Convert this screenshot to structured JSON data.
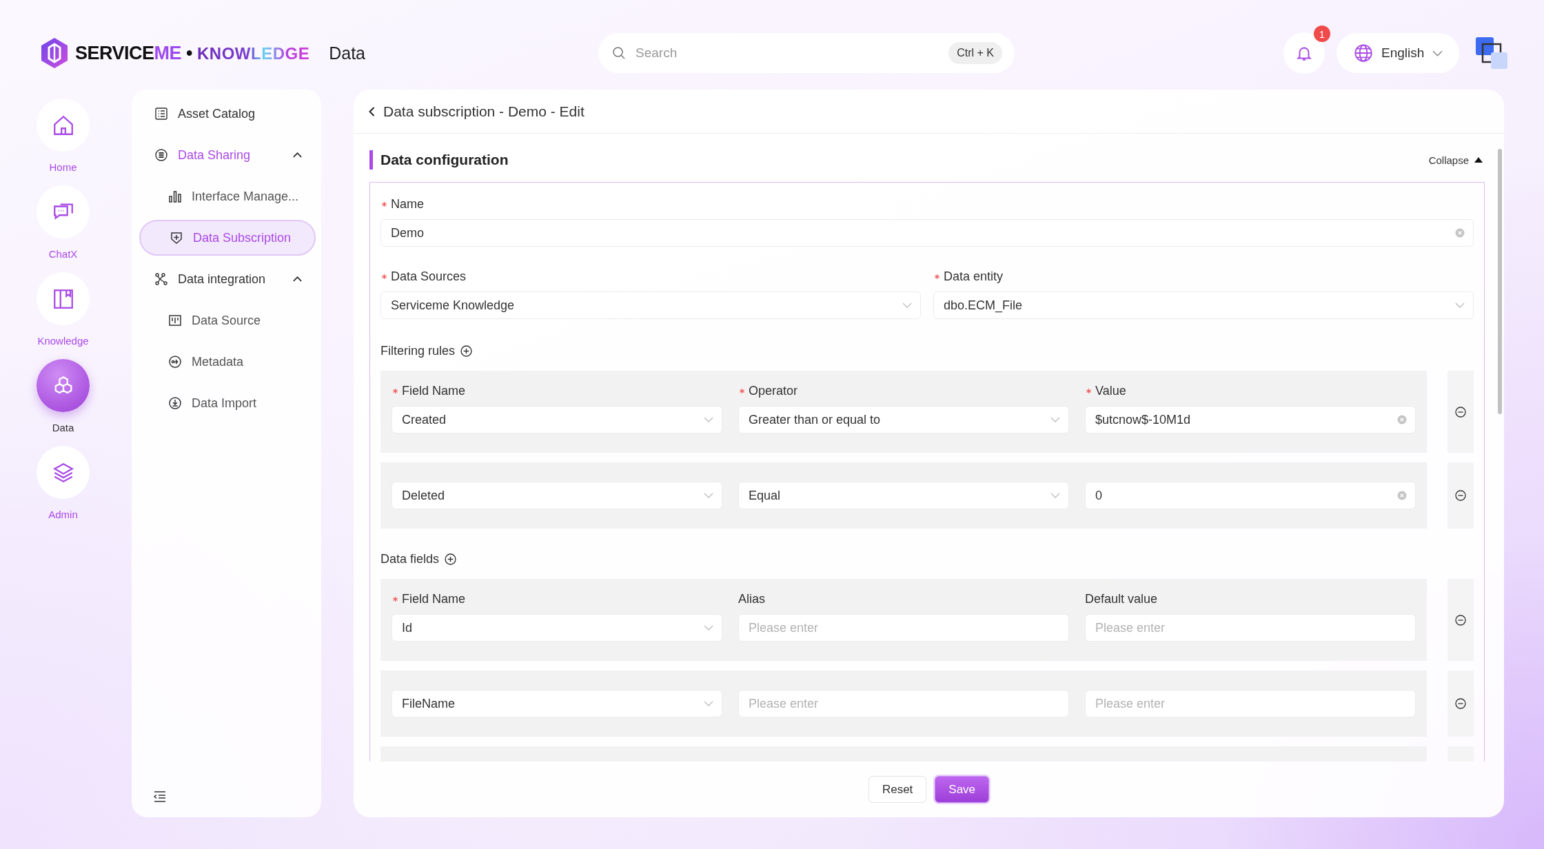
{
  "logo": {
    "name": "SERVICE",
    "name_accent": "ME",
    "separator": "•",
    "product": "KNOWLEDGE"
  },
  "app_section": "Data",
  "search": {
    "placeholder": "Search",
    "shortcut": "Ctrl + K"
  },
  "notifications": {
    "count": "1"
  },
  "language": {
    "label": "English"
  },
  "rail": [
    {
      "label": "Home",
      "selected": false
    },
    {
      "label": "ChatX",
      "selected": false
    },
    {
      "label": "Knowledge",
      "selected": false
    },
    {
      "label": "Data",
      "selected": true
    },
    {
      "label": "Admin",
      "selected": false
    }
  ],
  "sidebar": {
    "items": [
      {
        "label": "Asset Catalog",
        "selected": false
      },
      {
        "label": "Data Sharing",
        "selected": true,
        "expanded": true,
        "children": [
          {
            "label": "Interface Manage...",
            "selected": false
          },
          {
            "label": "Data Subscription",
            "selected": true
          }
        ]
      },
      {
        "label": "Data integration",
        "selected": false,
        "expanded": true,
        "children": [
          {
            "label": "Data Source",
            "selected": false
          },
          {
            "label": "Metadata",
            "selected": false
          },
          {
            "label": "Data Import",
            "selected": false
          }
        ]
      }
    ]
  },
  "page": {
    "title": "Data subscription - Demo - Edit"
  },
  "section": {
    "title": "Data configuration",
    "toggle_label": "Collapse",
    "expanded": true
  },
  "form": {
    "name": {
      "label": "Name",
      "required": true,
      "kind": "text",
      "value": "Demo"
    },
    "data_sources": {
      "label": "Data Sources",
      "required": true,
      "kind": "select",
      "value": "Serviceme Knowledge"
    },
    "data_entity": {
      "label": "Data entity",
      "required": true,
      "kind": "select",
      "value": "dbo.ECM_File"
    },
    "filtering_rules": {
      "label": "Filtering rules",
      "rows": [
        {
          "cells": [
            {
              "label": "Field Name",
              "required": true,
              "kind": "select",
              "value": "Created"
            },
            {
              "label": "Operator",
              "required": true,
              "kind": "select",
              "value": "Greater than or equal to"
            },
            {
              "label": "Value",
              "required": true,
              "kind": "text",
              "value": "$utcnow$-10M1d"
            }
          ]
        },
        {
          "cells": [
            {
              "kind": "select",
              "value": "Deleted"
            },
            {
              "kind": "select",
              "value": "Equal"
            },
            {
              "kind": "text",
              "value": "0"
            }
          ]
        }
      ]
    },
    "data_fields": {
      "label": "Data fields",
      "rows": [
        {
          "cells": [
            {
              "label": "Field Name",
              "required": true,
              "kind": "select",
              "value": "Id"
            },
            {
              "label": "Alias",
              "required": false,
              "kind": "input",
              "placeholder": "Please enter"
            },
            {
              "label": "Default value",
              "required": false,
              "kind": "input",
              "placeholder": "Please enter"
            }
          ]
        },
        {
          "cells": [
            {
              "kind": "select",
              "value": "FileName"
            },
            {
              "kind": "input",
              "placeholder": "Please enter"
            },
            {
              "kind": "input",
              "placeholder": "Please enter"
            }
          ]
        }
      ]
    }
  },
  "actions": [
    {
      "label": "Reset",
      "kind": "default"
    },
    {
      "label": "Save",
      "kind": "primary"
    }
  ]
}
